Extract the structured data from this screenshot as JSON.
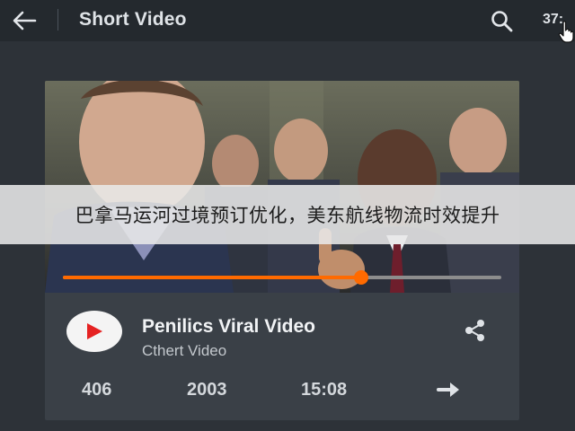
{
  "header": {
    "title": "Short Video",
    "count_text": "37:",
    "icons": {
      "back": "arrow-left-icon",
      "search": "search-icon",
      "cursor": "hand-cursor-icon"
    }
  },
  "video": {
    "title": "Penilics Viral Video",
    "subtitle": "Cthert Video",
    "progress_fraction": 0.68,
    "accent_color": "#ff6a00",
    "play_icon_color": "#e52222"
  },
  "stats": {
    "views": "406",
    "year": "2003",
    "duration": "15:08"
  },
  "actions": {
    "share": "share-icon",
    "next": "arrow-right-icon",
    "play": "play-icon"
  },
  "overlay": {
    "caption": "巴拿马运河过境预订优化，美东航线物流时效提升"
  }
}
